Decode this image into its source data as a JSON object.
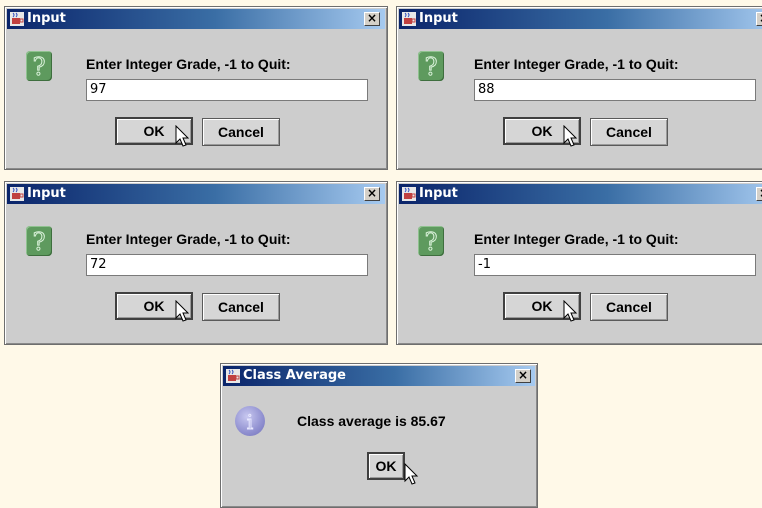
{
  "dialogs": [
    {
      "title": "Input",
      "prompt": "Enter Integer Grade, -1 to Quit:",
      "value": "97",
      "ok": "OK",
      "cancel": "Cancel",
      "close": "×"
    },
    {
      "title": "Input",
      "prompt": "Enter Integer Grade, -1 to Quit:",
      "value": "88",
      "ok": "OK",
      "cancel": "Cancel",
      "close": "×"
    },
    {
      "title": "Input",
      "prompt": "Enter Integer Grade, -1 to Quit:",
      "value": "72",
      "ok": "OK",
      "cancel": "Cancel",
      "close": "×"
    },
    {
      "title": "Input",
      "prompt": "Enter Integer Grade, -1 to Quit:",
      "value": "-1",
      "ok": "OK",
      "cancel": "Cancel",
      "close": "×"
    }
  ],
  "result_dialog": {
    "title": "Class Average",
    "message": "Class average is 85.67",
    "ok": "OK",
    "close": "×"
  },
  "icons": {
    "window_icon": "java-coffee-cup-icon",
    "question_icon": "question-icon",
    "info_icon": "information-icon"
  },
  "colors": {
    "background": "#fff9e8",
    "dialog": "#cdcdcd",
    "titlebar_start": "#0a246a",
    "titlebar_end": "#a6caf0",
    "question_icon": "#5e9a5e",
    "info_icon": "#9090d0"
  }
}
